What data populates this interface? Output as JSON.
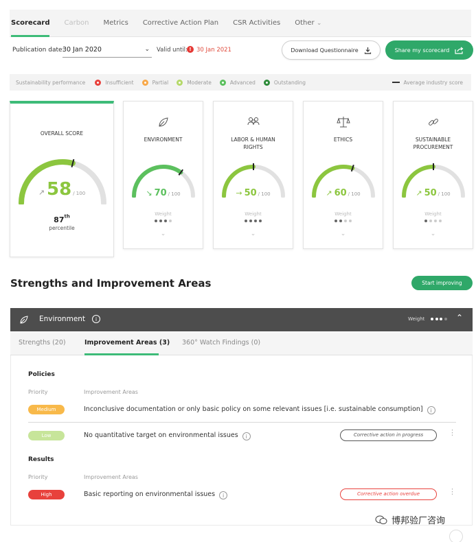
{
  "tabs": [
    {
      "label": "Scorecard"
    },
    {
      "label": "Carbon"
    },
    {
      "label": "Metrics"
    },
    {
      "label": "Corrective Action Plan"
    },
    {
      "label": "CSR Activities"
    },
    {
      "label": "Other"
    }
  ],
  "publication": {
    "label": "Publication date:",
    "value": "30 Jan 2020",
    "valid_label": "Valid until:",
    "valid_value": "30 Jan 2021"
  },
  "buttons": {
    "download": "Download Questionnaire",
    "share": "Share my scorecard",
    "start": "Start improving"
  },
  "legend": {
    "label": "Sustainability performance",
    "items": [
      {
        "label": "Insufficient",
        "color": "#e8413c"
      },
      {
        "label": "Partial",
        "color": "#f8a94a"
      },
      {
        "label": "Moderate",
        "color": "#b5d96a"
      },
      {
        "label": "Advanced",
        "color": "#5cc05e"
      },
      {
        "label": "Outstanding",
        "color": "#2e8b3a"
      }
    ],
    "avg_label": "Average industry score"
  },
  "overall": {
    "title": "OVERALL SCORE",
    "score": "58",
    "den": "/ 100",
    "fraction": 0.58,
    "color": "#8cc63f",
    "percentile_num": "87",
    "percentile_sup": "th",
    "percentile_label": "percentile"
  },
  "themes": [
    {
      "title": "ENVIRONMENT",
      "score": "70",
      "den": "/ 100",
      "fraction": 0.7,
      "color": "#5cc05e",
      "arrow": "↘",
      "icon": "leaf-icon",
      "weight_label": "Weight",
      "weight": 3
    },
    {
      "title": "LABOR & HUMAN RIGHTS",
      "score": "50",
      "den": "/ 100",
      "fraction": 0.5,
      "color": "#8cc63f",
      "arrow": "→",
      "icon": "people-icon",
      "weight_label": "Weight",
      "weight": 4
    },
    {
      "title": "ETHICS",
      "score": "60",
      "den": "/ 100",
      "fraction": 0.6,
      "color": "#8cc63f",
      "arrow": "↗",
      "icon": "scales-icon",
      "weight_label": "Weight",
      "weight": 2
    },
    {
      "title": "SUSTAINABLE PROCUREMENT",
      "score": "50",
      "den": "/ 100",
      "fraction": 0.5,
      "color": "#8cc63f",
      "arrow": "↗",
      "icon": "link-icon",
      "weight_label": "Weight",
      "weight": 1
    }
  ],
  "section": {
    "title": "Strengths and Improvement Areas"
  },
  "env_panel": {
    "name": "Environment",
    "weight_label": "Weight",
    "subtabs": [
      "Strengths (20)",
      "Improvement Areas (3)",
      "360° Watch Findings (0)"
    ]
  },
  "policies": {
    "title": "Policies",
    "col_priority": "Priority",
    "col_area": "Improvement Areas",
    "items": [
      {
        "priority": "Medium",
        "text": "Inconclusive documentation or only basic policy on some relevant issues [i.e. sustainable consumption]"
      },
      {
        "priority": "Low",
        "text": "No quantitative target on environmental issues",
        "action": "Corrective action in progress"
      }
    ]
  },
  "results": {
    "title": "Results",
    "col_priority": "Priority",
    "col_area": "Improvement Areas",
    "items": [
      {
        "priority": "High",
        "text": "Basic reporting on environmental issues",
        "action": "Corrective action overdue"
      }
    ]
  },
  "watermark": "博邦验厂咨询"
}
